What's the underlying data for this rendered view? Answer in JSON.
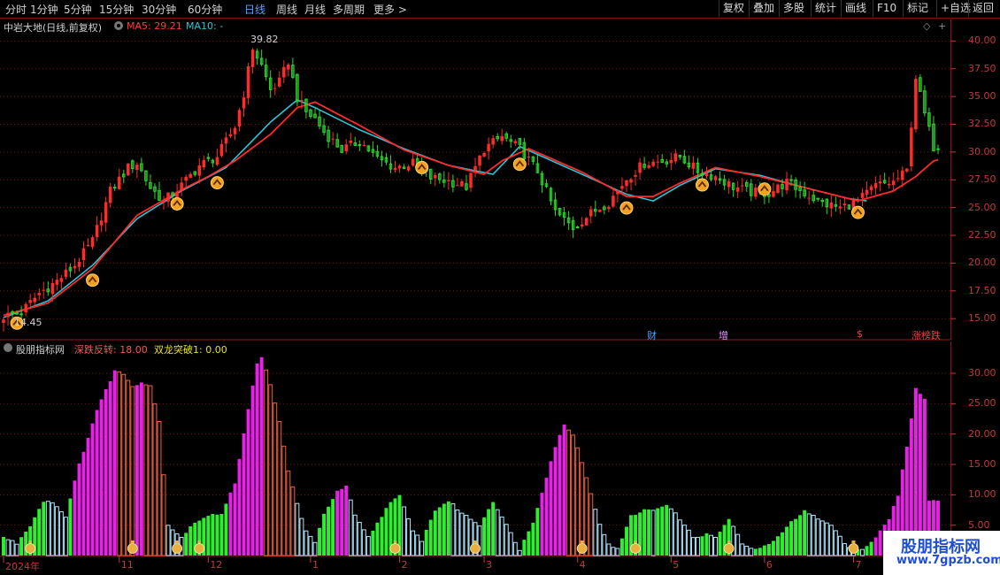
{
  "toolbar": {
    "periods": [
      "分时",
      "1分钟",
      "5分钟",
      "15分钟",
      "30分钟",
      "60分钟",
      "日线",
      "周线",
      "月线",
      "多周期",
      "更多 >"
    ],
    "active_index": 6,
    "right_buttons": [
      "复权",
      "叠加",
      "多股",
      "统计",
      "画线",
      "F10",
      "标记",
      "+自选",
      "返回"
    ]
  },
  "main_header": {
    "title": "中岩大地(日线,前复权)",
    "ma5_label": "MA5: 29.21",
    "ma10_label": "MA10: -",
    "ma5_color": "#ff3a3a",
    "ma10_color": "#2ec4d6",
    "high_label": "39.82",
    "low_label": "14.45"
  },
  "indicator_header": {
    "name": "股朋指标网",
    "s1_label": "深跌反转: 18.00",
    "s2_label": "双龙突破1: 0.00",
    "s1_color": "#ff5555",
    "s2_color": "#e8e020"
  },
  "event_markers": [
    "财",
    "增",
    "$",
    "涨榜跌"
  ],
  "watermark": {
    "line1": "股朋指标网",
    "line2": "www.7gpzb.com"
  },
  "colors": {
    "up": "#ff2a2a",
    "down": "#2cd62c",
    "ma5": "#ff2a2a",
    "ma10": "#2ec4d6",
    "grid": "#8a1a1a",
    "axis_text": "#c23a3a"
  },
  "chart_data": [
    {
      "type": "candlestick",
      "title": "中岩大地(日线,前复权)",
      "y_ticks": [
        15.0,
        17.5,
        20.0,
        22.5,
        25.0,
        27.5,
        30.0,
        32.5,
        35.0,
        37.5,
        40.0
      ],
      "y_tick_labels": [
        "15.00",
        "17.50",
        "20.00",
        "22.50",
        "25.00",
        "27.50",
        "30.00",
        "32.50",
        "35.00",
        "37.50",
        "40.00"
      ],
      "ylim": [
        13.9,
        41.3
      ],
      "x_labels": [
        "2024年",
        "11",
        "12",
        "1",
        "2",
        "3",
        "4",
        "5",
        "6",
        "7"
      ],
      "x_label_index": [
        0,
        26,
        46,
        69,
        89,
        108,
        129,
        150,
        171,
        191
      ],
      "n": 211,
      "close_anchors": [
        [
          0,
          15.2
        ],
        [
          4,
          15.6
        ],
        [
          8,
          17.3
        ],
        [
          12,
          18.4
        ],
        [
          16,
          19.8
        ],
        [
          20,
          22.0
        ],
        [
          24,
          26.5
        ],
        [
          28,
          28.6
        ],
        [
          30,
          29.0
        ],
        [
          33,
          26.8
        ],
        [
          36,
          25.6
        ],
        [
          40,
          27.0
        ],
        [
          44,
          28.8
        ],
        [
          48,
          29.6
        ],
        [
          52,
          32.3
        ],
        [
          54,
          35.3
        ],
        [
          56,
          39.4
        ],
        [
          58,
          37.8
        ],
        [
          60,
          35.6
        ],
        [
          62,
          36.3
        ],
        [
          64,
          38.2
        ],
        [
          66,
          34.9
        ],
        [
          68,
          33.6
        ],
        [
          70,
          33.0
        ],
        [
          72,
          31.8
        ],
        [
          76,
          30.2
        ],
        [
          80,
          31.0
        ],
        [
          84,
          29.4
        ],
        [
          88,
          28.6
        ],
        [
          92,
          29.0
        ],
        [
          96,
          27.7
        ],
        [
          100,
          27.4
        ],
        [
          104,
          26.9
        ],
        [
          108,
          30.3
        ],
        [
          112,
          31.4
        ],
        [
          116,
          30.3
        ],
        [
          120,
          28.3
        ],
        [
          124,
          24.6
        ],
        [
          128,
          23.2
        ],
        [
          132,
          24.5
        ],
        [
          136,
          25.5
        ],
        [
          140,
          27.6
        ],
        [
          144,
          29.0
        ],
        [
          148,
          29.2
        ],
        [
          152,
          29.6
        ],
        [
          156,
          28.3
        ],
        [
          160,
          27.8
        ],
        [
          164,
          26.9
        ],
        [
          168,
          26.4
        ],
        [
          172,
          26.3
        ],
        [
          176,
          27.3
        ],
        [
          180,
          26.3
        ],
        [
          184,
          25.4
        ],
        [
          188,
          25.0
        ],
        [
          192,
          25.6
        ],
        [
          196,
          27.0
        ],
        [
          200,
          27.3
        ],
        [
          203,
          28.3
        ],
        [
          205,
          36.8
        ],
        [
          207,
          33.4
        ],
        [
          209,
          30.5
        ],
        [
          210,
          30.6
        ]
      ],
      "ma10_anchors": [
        [
          0,
          15.1
        ],
        [
          10,
          16.6
        ],
        [
          20,
          19.8
        ],
        [
          30,
          24.0
        ],
        [
          40,
          26.5
        ],
        [
          50,
          28.6
        ],
        [
          60,
          32.7
        ],
        [
          66,
          34.7
        ],
        [
          70,
          34.0
        ],
        [
          80,
          32.0
        ],
        [
          90,
          30.3
        ],
        [
          100,
          28.8
        ],
        [
          110,
          28.0
        ],
        [
          116,
          30.5
        ],
        [
          130,
          28.0
        ],
        [
          140,
          26.2
        ],
        [
          146,
          25.6
        ],
        [
          152,
          27.0
        ],
        [
          160,
          28.5
        ],
        [
          170,
          27.9
        ],
        [
          180,
          26.8
        ],
        [
          190,
          25.8
        ],
        [
          194,
          25.6
        ]
      ],
      "ma5_anchors": [
        [
          0,
          15.3
        ],
        [
          10,
          16.4
        ],
        [
          20,
          19.5
        ],
        [
          30,
          24.3
        ],
        [
          40,
          26.6
        ],
        [
          46,
          27.8
        ],
        [
          52,
          29.2
        ],
        [
          60,
          31.6
        ],
        [
          66,
          34.0
        ],
        [
          70,
          34.5
        ],
        [
          80,
          32.4
        ],
        [
          90,
          30.2
        ],
        [
          100,
          28.8
        ],
        [
          108,
          28.0
        ],
        [
          112,
          29.2
        ],
        [
          118,
          30.3
        ],
        [
          130,
          28.2
        ],
        [
          140,
          26.0
        ],
        [
          146,
          26.0
        ],
        [
          152,
          27.2
        ],
        [
          160,
          28.6
        ],
        [
          170,
          27.8
        ],
        [
          180,
          26.8
        ],
        [
          192,
          25.6
        ],
        [
          200,
          26.5
        ],
        [
          205,
          27.8
        ],
        [
          209,
          29.2
        ],
        [
          210,
          29.3
        ]
      ],
      "buy_signal_index": [
        3,
        20,
        39,
        48,
        94,
        116,
        140,
        157,
        171,
        192
      ]
    },
    {
      "type": "bar",
      "title": "股朋指标网",
      "y_ticks": [
        5.0,
        10.0,
        15.0,
        20.0,
        25.0,
        30.0
      ],
      "y_tick_labels": [
        "5.00",
        "10.00",
        "15.00",
        "20.00",
        "25.00",
        "30.00"
      ],
      "ylim": [
        0,
        33.5
      ],
      "value_anchors": [
        [
          0,
          3.0
        ],
        [
          3,
          2.0
        ],
        [
          6,
          5.0
        ],
        [
          9,
          9.0
        ],
        [
          11,
          8.8
        ],
        [
          14,
          6.5
        ],
        [
          17,
          15
        ],
        [
          21,
          24
        ],
        [
          25,
          30.5
        ],
        [
          27,
          29.8
        ],
        [
          29,
          28.0
        ],
        [
          31,
          28.5
        ],
        [
          33,
          28.0
        ],
        [
          35,
          22.0
        ],
        [
          37,
          5.0
        ],
        [
          40,
          3.0
        ],
        [
          43,
          5.5
        ],
        [
          46,
          6.5
        ],
        [
          49,
          7.0
        ],
        [
          52,
          12.0
        ],
        [
          55,
          24.0
        ],
        [
          57,
          31.8
        ],
        [
          58,
          32.8
        ],
        [
          60,
          28.0
        ],
        [
          62,
          22.0
        ],
        [
          64,
          14.0
        ],
        [
          66,
          8.5
        ],
        [
          68,
          4.0
        ],
        [
          70,
          2.0
        ],
        [
          72,
          7.0
        ],
        [
          75,
          10.5
        ],
        [
          77,
          11.5
        ],
        [
          79,
          6.5
        ],
        [
          82,
          3.0
        ],
        [
          85,
          6.5
        ],
        [
          87,
          9.0
        ],
        [
          89,
          9.8
        ],
        [
          92,
          4.0
        ],
        [
          94,
          2.5
        ],
        [
          97,
          7.5
        ],
        [
          100,
          9.0
        ],
        [
          103,
          7.0
        ],
        [
          107,
          5.0
        ],
        [
          110,
          9.0
        ],
        [
          113,
          5.0
        ],
        [
          116,
          1.0
        ],
        [
          119,
          5.5
        ],
        [
          122,
          13
        ],
        [
          124,
          18
        ],
        [
          126,
          21.5
        ],
        [
          128,
          20.0
        ],
        [
          131,
          13.0
        ],
        [
          134,
          5.0
        ],
        [
          136,
          2.0
        ],
        [
          138,
          1.0
        ],
        [
          141,
          6.5
        ],
        [
          144,
          7.5
        ],
        [
          146,
          7.5
        ],
        [
          149,
          8.5
        ],
        [
          152,
          6.0
        ],
        [
          155,
          3.0
        ],
        [
          158,
          3.5
        ],
        [
          160,
          3.0
        ],
        [
          163,
          6.0
        ],
        [
          166,
          2.0
        ],
        [
          168,
          1.0
        ],
        [
          171,
          1.5
        ],
        [
          174,
          3.0
        ],
        [
          177,
          5.5
        ],
        [
          180,
          7.5
        ],
        [
          183,
          6.0
        ],
        [
          186,
          5.0
        ],
        [
          189,
          2.0
        ],
        [
          191,
          1.0
        ],
        [
          193,
          1.0
        ],
        [
          196,
          3.0
        ],
        [
          199,
          6.0
        ],
        [
          201,
          10.0
        ],
        [
          203,
          18.0
        ],
        [
          205,
          27.5
        ],
        [
          206,
          26.5
        ],
        [
          207,
          26.0
        ],
        [
          208,
          9.0
        ]
      ],
      "bar_colors": [
        "#e820e8",
        "#f06040",
        "#2cf02c",
        "#aee8ff"
      ],
      "money_signal_index": [
        6,
        29,
        39,
        44,
        88,
        106,
        130,
        142,
        163,
        191
      ]
    }
  ]
}
